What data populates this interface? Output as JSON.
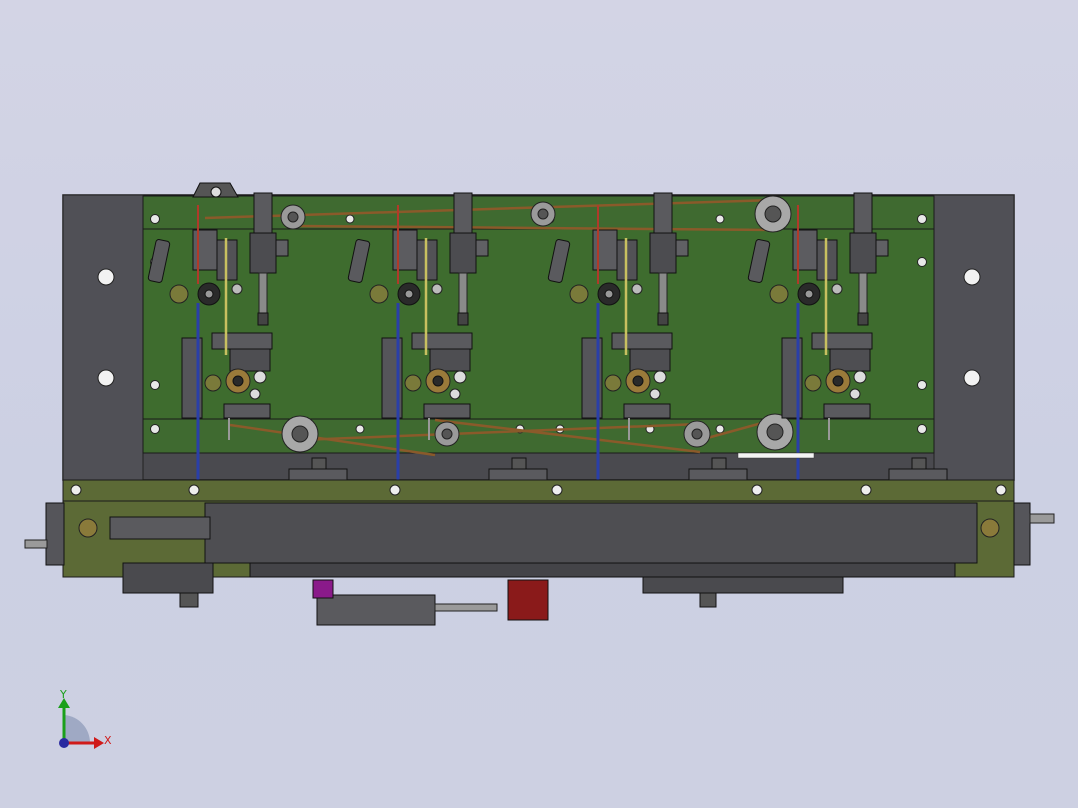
{
  "viewport": {
    "background_top": "#d3d4e5",
    "background_bottom": "#cdd0e2"
  },
  "model": {
    "frame_color": "#4a4a4f",
    "plate_color": "#3f6a30",
    "plate_dark": "#2e5424",
    "rail_color": "#5c6a36",
    "slide_color": "#4e4e52",
    "belt_color": "#8a5a2a",
    "wire_blue": "#2a3fa8",
    "wire_red": "#b03a2a",
    "wire_yellow": "#c8c060",
    "actuator_red": "#8a1a1a",
    "actuator_magenta": "#8a1a8a",
    "station_count": 4
  },
  "triad": {
    "y_label": "Y",
    "x_label": "X",
    "y_color": "#1aa01a",
    "x_color": "#d01a1a",
    "origin_color": "#2a2aa0"
  }
}
